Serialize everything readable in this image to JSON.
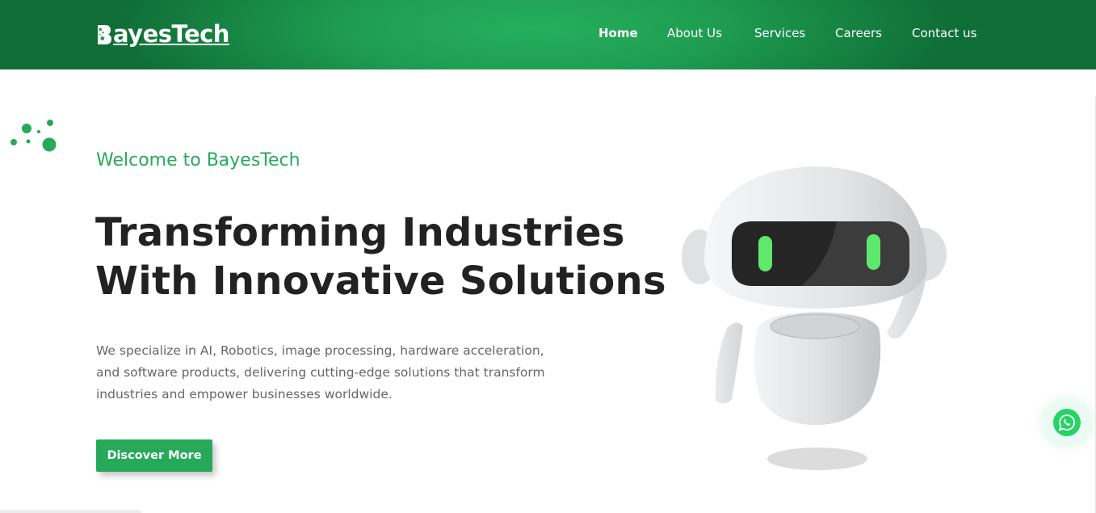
{
  "brand": {
    "logo_text": "ayesTech",
    "logo_letter": "B",
    "colors": {
      "primary_green": "#27a95a",
      "header_dark": "#0f6e36",
      "header_light": "#25b05c",
      "whatsapp": "#25d366",
      "heading": "#222222",
      "body_text": "#666666"
    }
  },
  "nav": {
    "items": [
      {
        "label": "Home",
        "active": true
      },
      {
        "label": "About Us",
        "active": false
      },
      {
        "label": "Services",
        "active": false
      },
      {
        "label": "Careers",
        "active": false
      },
      {
        "label": "Contact us",
        "active": false
      }
    ]
  },
  "hero": {
    "welcome": "Welcome to BayesTech",
    "headline_line1": "Transforming Industries",
    "headline_line2": "With Innovative Solutions",
    "description": "We specialize in AI, Robotics, image processing, hardware acceleration, and software products, delivering cutting-edge solutions that transform industries and empower businesses worldwide.",
    "cta_label": "Discover More",
    "illustration_icon": "robot-illustration"
  },
  "floating": {
    "whatsapp_icon": "whatsapp-icon"
  }
}
